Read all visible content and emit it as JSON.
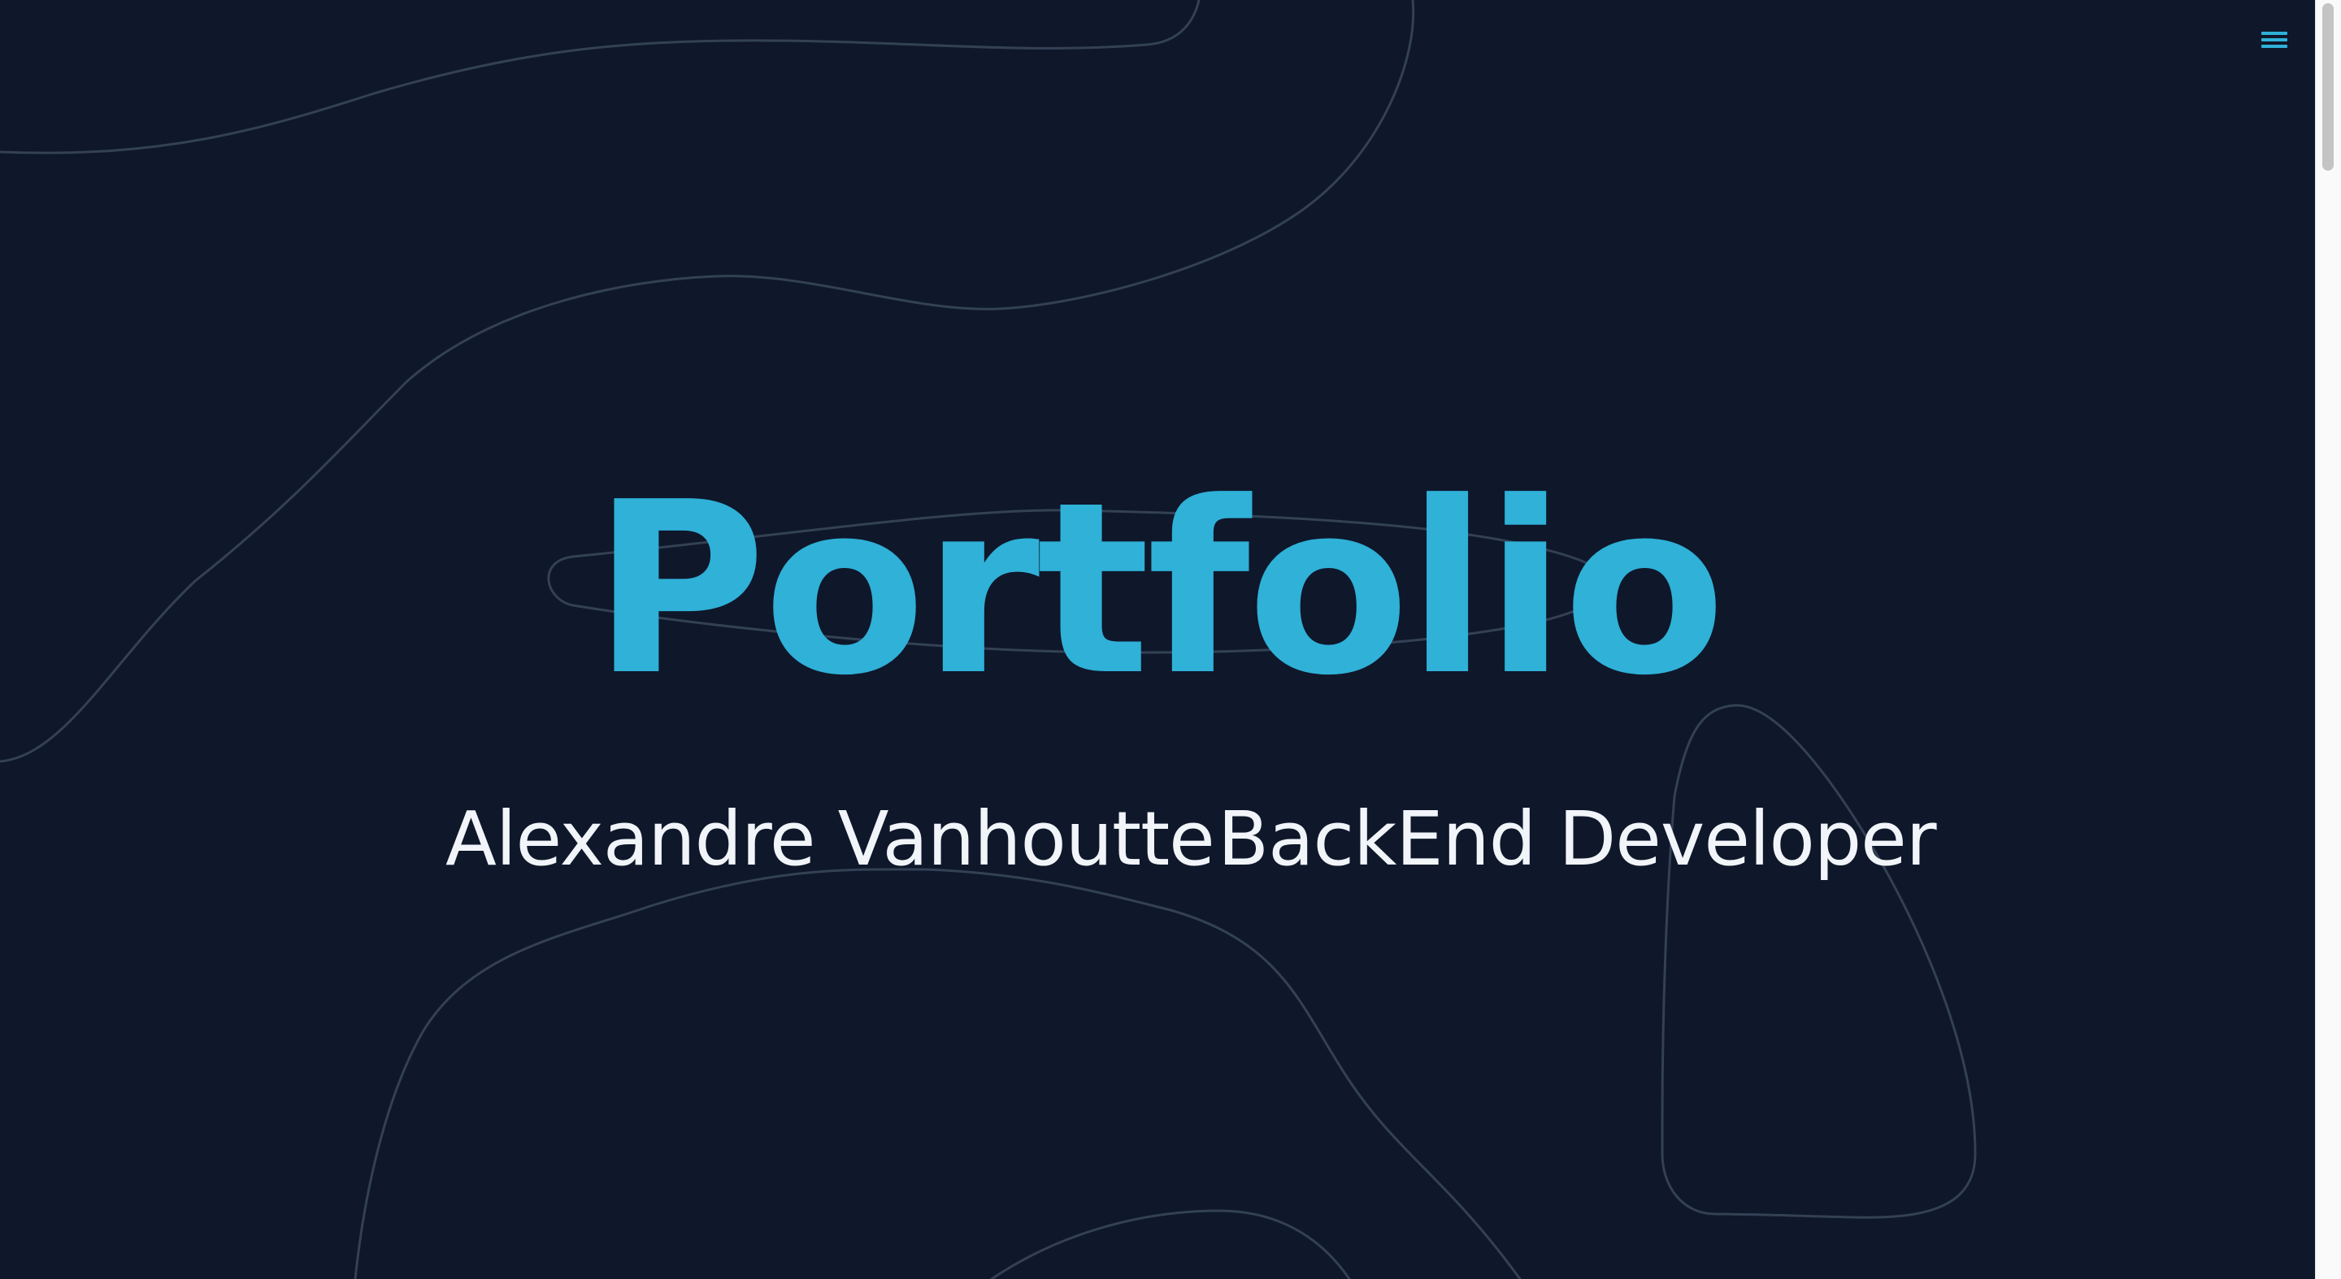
{
  "hero": {
    "title": "Portfolio",
    "name": "Alexandre Vanhoutte",
    "role": "BackEnd Developer"
  },
  "menu": {
    "icon": "hamburger-menu-icon"
  },
  "colors": {
    "background": "#0f172a",
    "accent": "#2fb1d8",
    "text": "#f1f5f9",
    "contour": "#334155"
  }
}
